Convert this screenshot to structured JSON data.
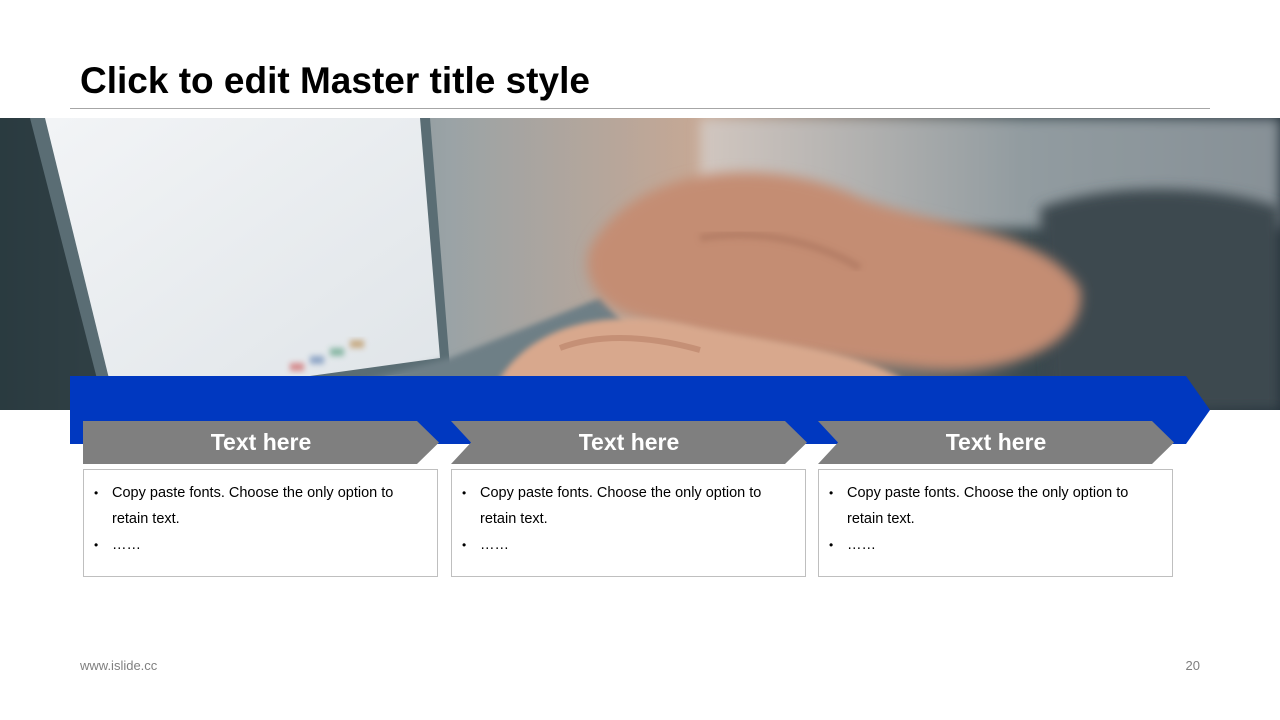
{
  "slide": {
    "title": "Click to edit Master title style",
    "footer_url": "www.islide.cc",
    "page_number": "20"
  },
  "colors": {
    "band": "#0038c0",
    "tab": "#7f7f7f",
    "box_border": "#bfbfbf"
  },
  "hero_image": {
    "icon": "laptop-typing-photo"
  },
  "columns": [
    {
      "heading": "Text here",
      "bullets": [
        "Copy paste fonts. Choose the only option to retain text.",
        "……"
      ]
    },
    {
      "heading": "Text here",
      "bullets": [
        "Copy paste fonts. Choose the only option to retain text.",
        "……"
      ]
    },
    {
      "heading": "Text here",
      "bullets": [
        "Copy paste fonts. Choose the only option to retain text.",
        "……"
      ]
    }
  ]
}
